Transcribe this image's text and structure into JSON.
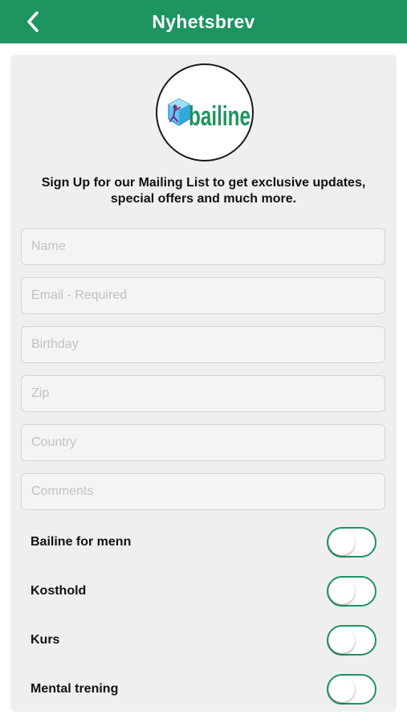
{
  "header": {
    "title": "Nyhetsbrev",
    "back_icon": "chevron-left-icon"
  },
  "logo": {
    "text": "bailine"
  },
  "intro": {
    "line1": "Sign Up for our Mailing List to get exclusive updates,",
    "line2": "special offers and much more."
  },
  "form": {
    "fields": [
      {
        "placeholder": "Name",
        "value": ""
      },
      {
        "placeholder": "Email - Required",
        "value": ""
      },
      {
        "placeholder": "Birthday",
        "value": ""
      },
      {
        "placeholder": "Zip",
        "value": ""
      },
      {
        "placeholder": "Country",
        "value": ""
      },
      {
        "placeholder": "Comments",
        "value": ""
      }
    ]
  },
  "toggles": [
    {
      "label": "Bailine for menn",
      "on": false
    },
    {
      "label": "Kosthold",
      "on": false
    },
    {
      "label": "Kurs",
      "on": false
    },
    {
      "label": "Mental trening",
      "on": false
    }
  ],
  "colors": {
    "accent": "#1e9460",
    "card": "#efefef",
    "placeholder": "#c2c2c2"
  }
}
